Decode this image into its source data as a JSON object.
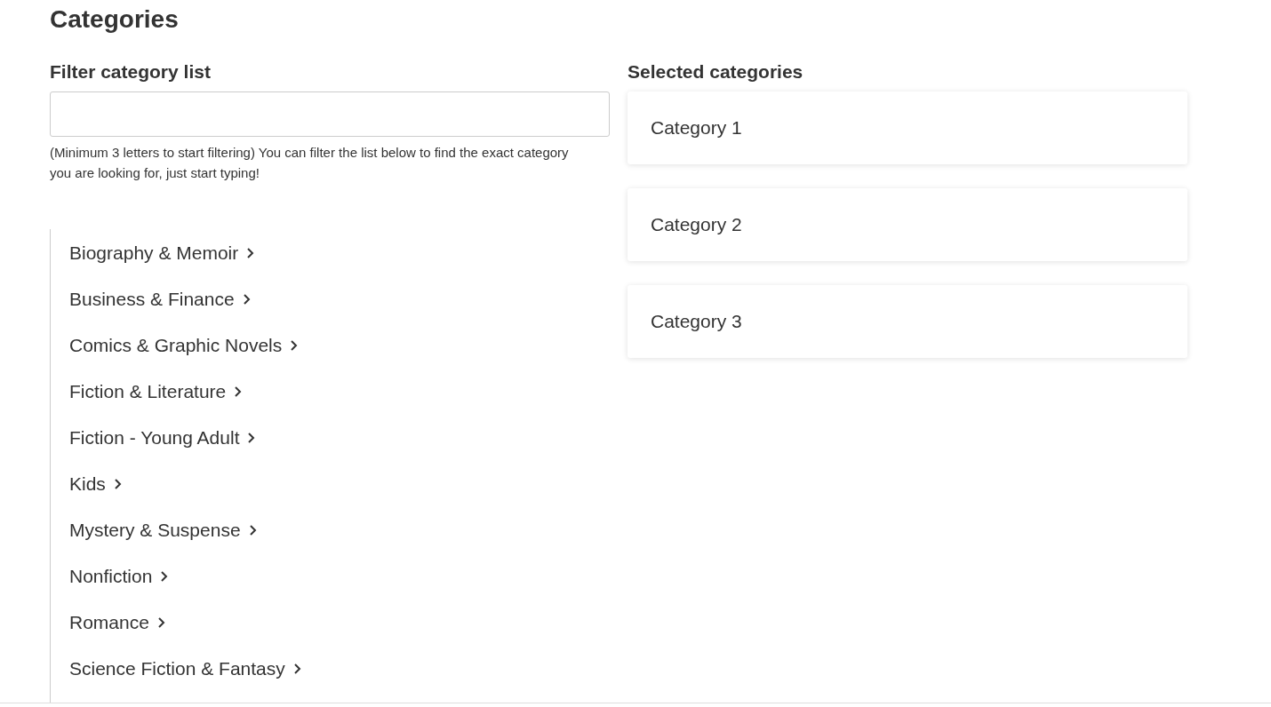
{
  "title": "Categories",
  "filter": {
    "label": "Filter category list",
    "help": "(Minimum 3 letters to start filtering) You can filter the list below to find the exact category you are looking for, just start typing!"
  },
  "categories": [
    {
      "label": "Biography & Memoir"
    },
    {
      "label": "Business & Finance"
    },
    {
      "label": "Comics & Graphic Novels"
    },
    {
      "label": "Fiction & Literature"
    },
    {
      "label": "Fiction - Young Adult"
    },
    {
      "label": "Kids"
    },
    {
      "label": "Mystery & Suspense"
    },
    {
      "label": "Nonfiction"
    },
    {
      "label": "Romance"
    },
    {
      "label": "Science Fiction & Fantasy"
    }
  ],
  "selected": {
    "label": "Selected categories",
    "items": [
      "Category 1",
      "Category 2",
      "Category 3"
    ]
  }
}
